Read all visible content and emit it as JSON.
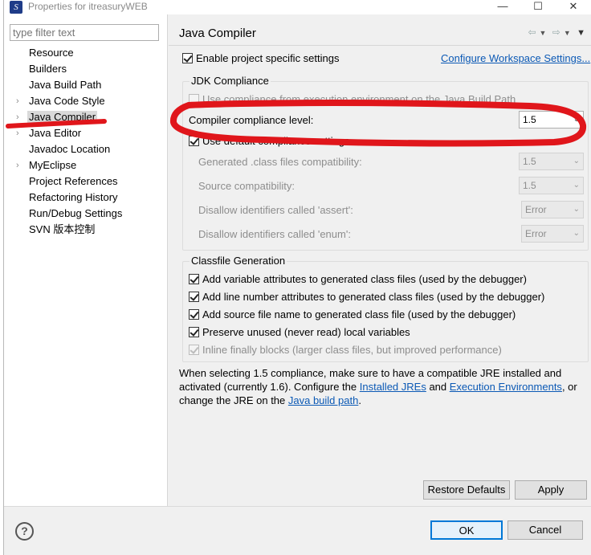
{
  "window": {
    "title": "Properties for itreasuryWEB",
    "minimize": "—",
    "maximize": "☐",
    "close": "✕"
  },
  "filter": {
    "placeholder": "type filter text"
  },
  "tree": [
    {
      "label": "Resource",
      "expandable": false,
      "selected": false
    },
    {
      "label": "Builders",
      "expandable": false,
      "selected": false
    },
    {
      "label": "Java Build Path",
      "expandable": false,
      "selected": false
    },
    {
      "label": "Java Code Style",
      "expandable": true,
      "selected": false
    },
    {
      "label": "Java Compiler",
      "expandable": true,
      "selected": true
    },
    {
      "label": "Java Editor",
      "expandable": true,
      "selected": false
    },
    {
      "label": "Javadoc Location",
      "expandable": false,
      "selected": false
    },
    {
      "label": "MyEclipse",
      "expandable": true,
      "selected": false
    },
    {
      "label": "Project References",
      "expandable": false,
      "selected": false
    },
    {
      "label": "Refactoring History",
      "expandable": false,
      "selected": false
    },
    {
      "label": "Run/Debug Settings",
      "expandable": false,
      "selected": false
    },
    {
      "label": "SVN 版本控制",
      "expandable": false,
      "selected": false
    }
  ],
  "page": {
    "title": "Java Compiler",
    "enable_specific": "Enable project specific settings",
    "configure_workspace": "Configure Workspace Settings..."
  },
  "jdk": {
    "group_title": "JDK Compliance",
    "use_compliance_env": "Use compliance from execution environment on the Java Build Path",
    "compliance_level_label": "Compiler compliance level:",
    "compliance_level_value": "1.5",
    "use_default": "Use default compliance settings",
    "generated_label": "Generated .class files compatibility:",
    "generated_value": "1.5",
    "source_label": "Source compatibility:",
    "source_value": "1.5",
    "assert_label": "Disallow identifiers called 'assert':",
    "assert_value": "Error",
    "enum_label": "Disallow identifiers called 'enum':",
    "enum_value": "Error"
  },
  "classfile": {
    "group_title": "Classfile Generation",
    "opt1": "Add variable attributes to generated class files (used by the debugger)",
    "opt2": "Add line number attributes to generated class files (used by the debugger)",
    "opt3": "Add source file name to generated class file (used by the debugger)",
    "opt4": "Preserve unused (never read) local variables",
    "opt5": "Inline finally blocks (larger class files, but improved performance)"
  },
  "info": {
    "text1": "When selecting 1.5 compliance, make sure to have a compatible JRE installed and activated (currently 1.6). Configure the ",
    "link1": "Installed JREs",
    "text2": " and ",
    "link2": "Execution Environments",
    "text3": ", or change the JRE on the ",
    "link3": "Java build path",
    "text4": "."
  },
  "buttons": {
    "restore_defaults": "Restore Defaults",
    "apply": "Apply",
    "ok": "OK",
    "cancel": "Cancel",
    "help": "?"
  },
  "colors": {
    "annotation_red": "#e0161b",
    "link_blue": "#0b59b5",
    "default_button_border": "#0078d7"
  }
}
